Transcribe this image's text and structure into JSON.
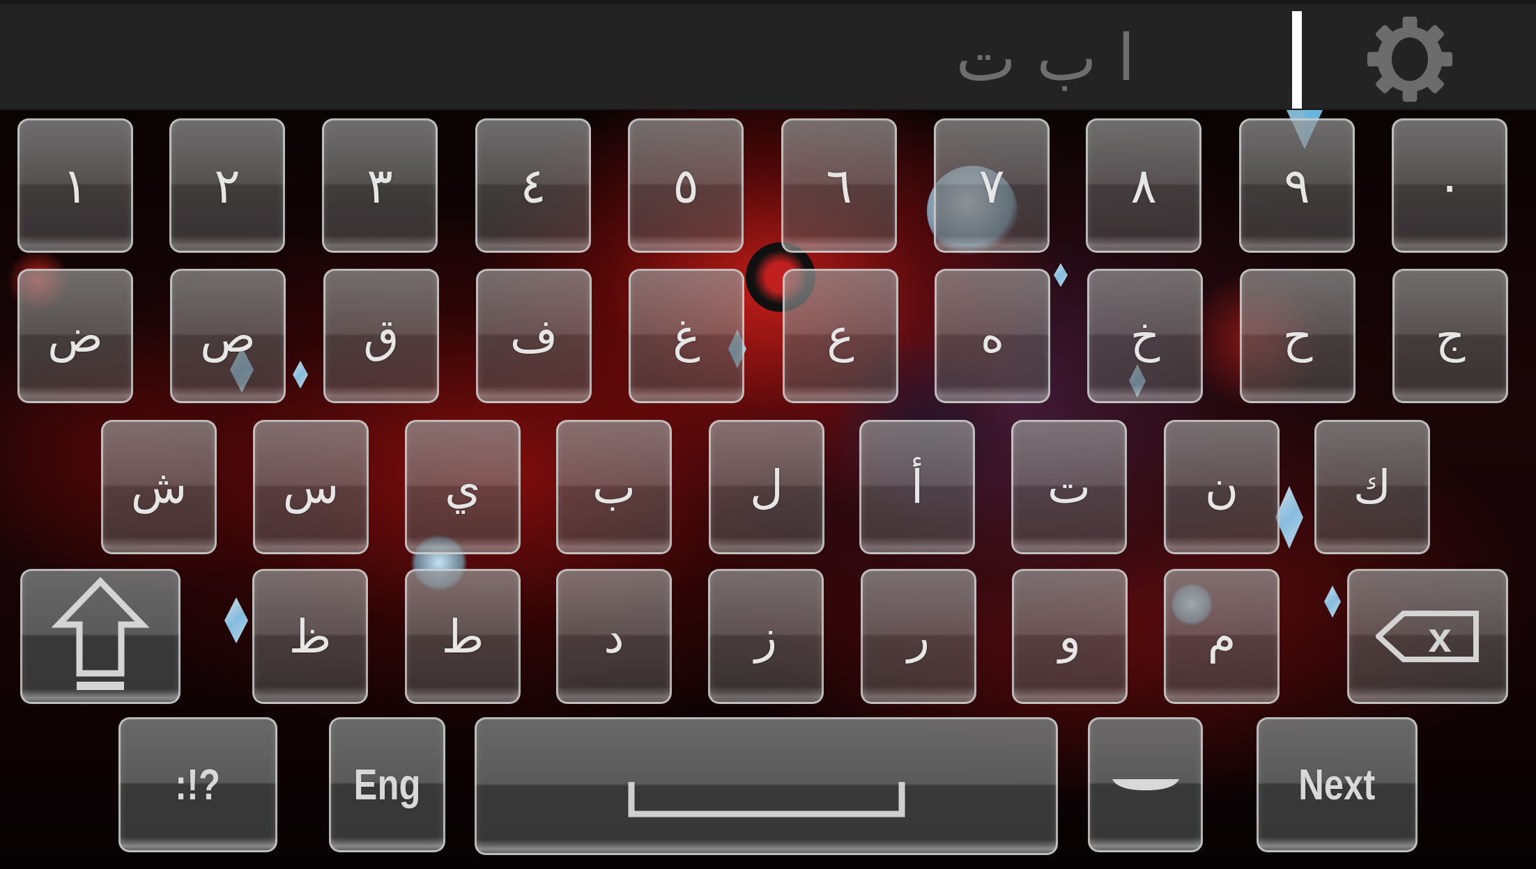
{
  "top_bar": {
    "suggestion_text": "ا ب ت",
    "cursor_indicator": "text-cursor",
    "settings_icon": "gear-icon"
  },
  "colors": {
    "top_bar_bg": "#232323",
    "key_text": "#e6e6e6",
    "suggestion_text": "#6e6e6e",
    "accent_gem": "#8fd0f5"
  },
  "keyboard": {
    "language": "Arabic",
    "rows": [
      [
        "١",
        "٢",
        "٣",
        "٤",
        "٥",
        "٦",
        "٧",
        "٨",
        "٩",
        "٠"
      ],
      [
        "ض",
        "ص",
        "ق",
        "ف",
        "غ",
        "ع",
        "ه",
        "خ",
        "ح",
        "ج"
      ],
      [
        "ش",
        "س",
        "ي",
        "ب",
        "ل",
        "أ",
        "ت",
        "ن",
        "ك"
      ],
      [
        "ظ",
        "ط",
        "د",
        "ز",
        "ر",
        "و",
        "م"
      ]
    ],
    "shift_icon": "shift-arrow-icon",
    "backspace_icon": "backspace-icon",
    "bottom_row": {
      "symbols_label": ":!?",
      "language_label": "Eng",
      "space_icon": "space-bar-icon",
      "dash_label": "ـ",
      "next_label": "Next"
    }
  }
}
